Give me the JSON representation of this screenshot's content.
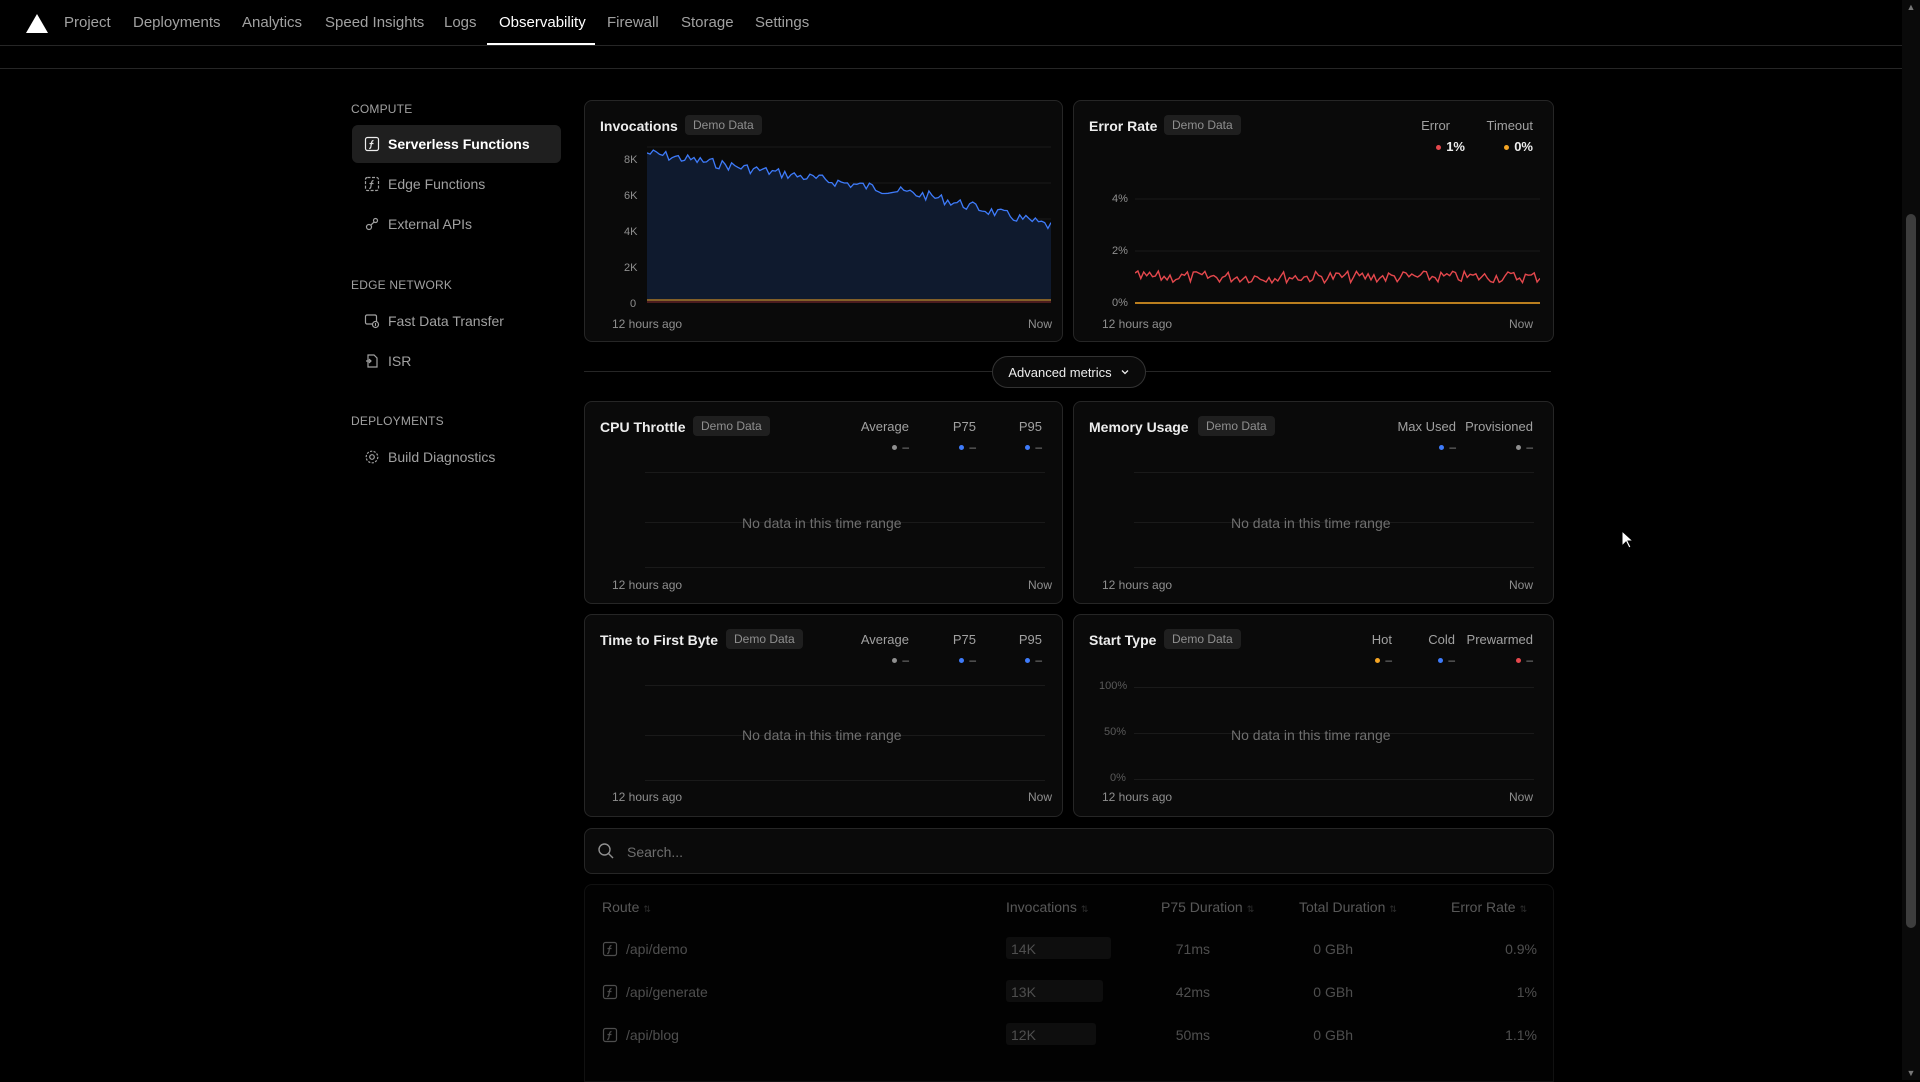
{
  "nav": {
    "items": [
      {
        "label": "Project"
      },
      {
        "label": "Deployments"
      },
      {
        "label": "Analytics"
      },
      {
        "label": "Speed Insights"
      },
      {
        "label": "Logs"
      },
      {
        "label": "Observability"
      },
      {
        "label": "Firewall"
      },
      {
        "label": "Storage"
      },
      {
        "label": "Settings"
      }
    ],
    "active": "Observability"
  },
  "sidebar": {
    "sections": [
      {
        "heading": "COMPUTE",
        "items": [
          {
            "label": "Serverless Functions",
            "icon": "function-icon",
            "active": true
          },
          {
            "label": "Edge Functions",
            "icon": "edge-function-icon"
          },
          {
            "label": "External APIs",
            "icon": "external-api-icon"
          }
        ]
      },
      {
        "heading": "EDGE NETWORK",
        "items": [
          {
            "label": "Fast Data Transfer",
            "icon": "data-transfer-icon"
          },
          {
            "label": "ISR",
            "icon": "isr-icon"
          }
        ]
      },
      {
        "heading": "DEPLOYMENTS",
        "items": [
          {
            "label": "Build Diagnostics",
            "icon": "gear-icon"
          }
        ]
      }
    ]
  },
  "common": {
    "demo_badge": "Demo Data",
    "time_start": "12 hours ago",
    "time_end": "Now",
    "no_data": "No data in this time range",
    "dash": "–"
  },
  "colors": {
    "blue": "#3e7bfa",
    "red": "#e5484d",
    "orange": "#f5a524",
    "gray": "#8f8f8f"
  },
  "invocations": {
    "title": "Invocations",
    "y_ticks": [
      "8K",
      "6K",
      "4K",
      "2K",
      "0"
    ]
  },
  "error_rate": {
    "title": "Error Rate",
    "legend": [
      {
        "label": "Error",
        "value": "1%",
        "color": "#e5484d"
      },
      {
        "label": "Timeout",
        "value": "0%",
        "color": "#f5a524"
      }
    ],
    "y_ticks": [
      "4%",
      "2%",
      "0%"
    ]
  },
  "advanced_metrics": {
    "label": "Advanced metrics"
  },
  "cpu_throttle": {
    "title": "CPU Throttle",
    "legend": [
      {
        "label": "Average",
        "color": "#8f8f8f"
      },
      {
        "label": "P75",
        "color": "#3e7bfa"
      },
      {
        "label": "P95",
        "color": "#3e7bfa"
      }
    ]
  },
  "memory_usage": {
    "title": "Memory Usage",
    "legend": [
      {
        "label": "Max Used",
        "color": "#3e7bfa"
      },
      {
        "label": "Provisioned",
        "color": "#8f8f8f"
      }
    ]
  },
  "ttfb": {
    "title": "Time to First Byte",
    "legend": [
      {
        "label": "Average",
        "color": "#8f8f8f"
      },
      {
        "label": "P75",
        "color": "#3e7bfa"
      },
      {
        "label": "P95",
        "color": "#3e7bfa"
      }
    ]
  },
  "start_type": {
    "title": "Start Type",
    "legend": [
      {
        "label": "Hot",
        "color": "#f5a524"
      },
      {
        "label": "Cold",
        "color": "#3e7bfa"
      },
      {
        "label": "Prewarmed",
        "color": "#e5484d"
      }
    ],
    "y_ticks": [
      "100%",
      "50%",
      "0%"
    ]
  },
  "search": {
    "placeholder": "Search..."
  },
  "table": {
    "columns": [
      "Route",
      "Invocations",
      "P75 Duration",
      "Total Duration",
      "Error Rate"
    ],
    "rows": [
      {
        "route": "/api/demo",
        "invocations": "14K",
        "p75": "71ms",
        "total": "0 GBh",
        "error": "0.9%"
      },
      {
        "route": "/api/generate",
        "invocations": "13K",
        "p75": "42ms",
        "total": "0 GBh",
        "error": "1%"
      },
      {
        "route": "/api/blog",
        "invocations": "12K",
        "p75": "50ms",
        "total": "0 GBh",
        "error": "1.1%"
      }
    ]
  }
}
